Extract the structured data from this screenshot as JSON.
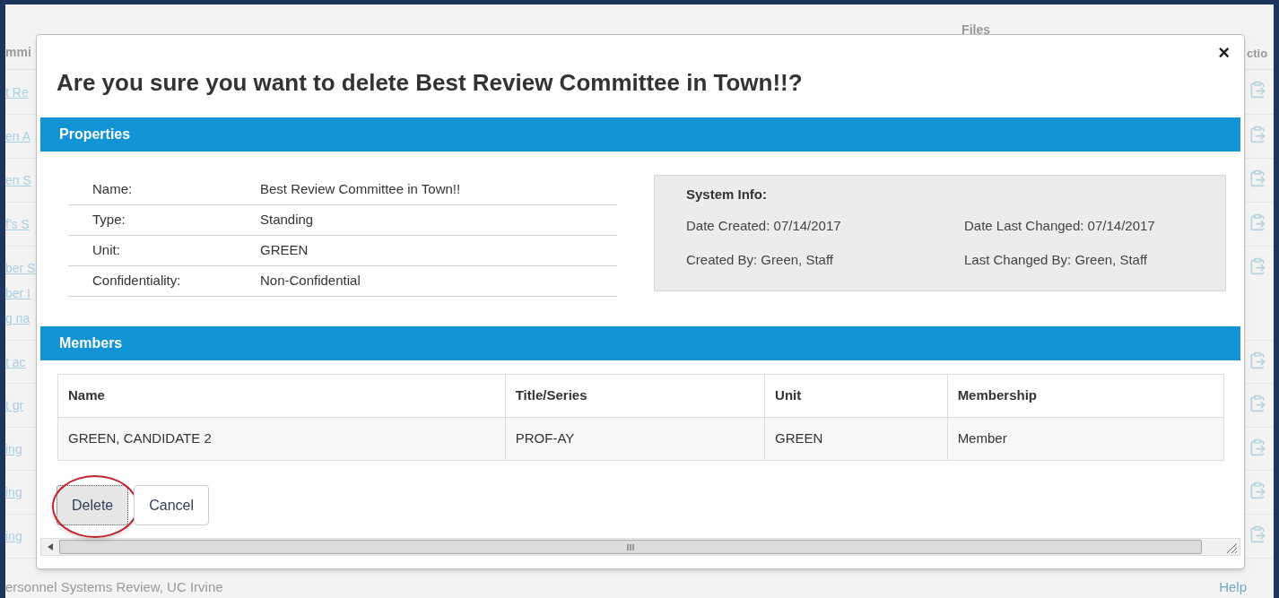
{
  "background": {
    "header_left": "mmi",
    "header_files": "Files",
    "header_right": "ctio",
    "rows": [
      {
        "links": [
          "t Re"
        ]
      },
      {
        "links": [
          "en A"
        ]
      },
      {
        "links": [
          "en S"
        ]
      },
      {
        "links": [
          "f's S"
        ]
      },
      {
        "links": [
          "ber S",
          "ber I",
          "g na"
        ]
      },
      {
        "links": [
          "t ac"
        ]
      },
      {
        "links": [
          "t gr"
        ]
      },
      {
        "links": [
          "ing"
        ]
      },
      {
        "links": [
          "ing"
        ]
      },
      {
        "links": [
          "ing"
        ]
      }
    ],
    "footer": "ersonnel Systems Review, UC Irvine",
    "footer_link": "Help"
  },
  "dialog": {
    "close": "×",
    "title": "Are you sure you want to delete Best Review Committee in Town!!?",
    "properties_header": "Properties",
    "properties": [
      {
        "label": "Name:",
        "value": "Best Review Committee in Town!!"
      },
      {
        "label": "Type:",
        "value": "Standing"
      },
      {
        "label": "Unit:",
        "value": "GREEN"
      },
      {
        "label": "Confidentiality:",
        "value": "Non-Confidential"
      }
    ],
    "system_info": {
      "title": "System Info:",
      "items": [
        "Date Created: 07/14/2017",
        "Date Last Changed: 07/14/2017",
        "Created By: Green, Staff",
        "Last Changed By: Green, Staff"
      ]
    },
    "members_header": "Members",
    "members": {
      "columns": [
        "Name",
        "Title/Series",
        "Unit",
        "Membership"
      ],
      "rows": [
        [
          "GREEN, CANDIDATE 2",
          "PROF-AY",
          "GREEN",
          "Member"
        ]
      ]
    },
    "buttons": [
      {
        "label": "Delete",
        "focused": true,
        "highlighted": true
      },
      {
        "label": "Cancel",
        "focused": false,
        "highlighted": false
      }
    ]
  }
}
